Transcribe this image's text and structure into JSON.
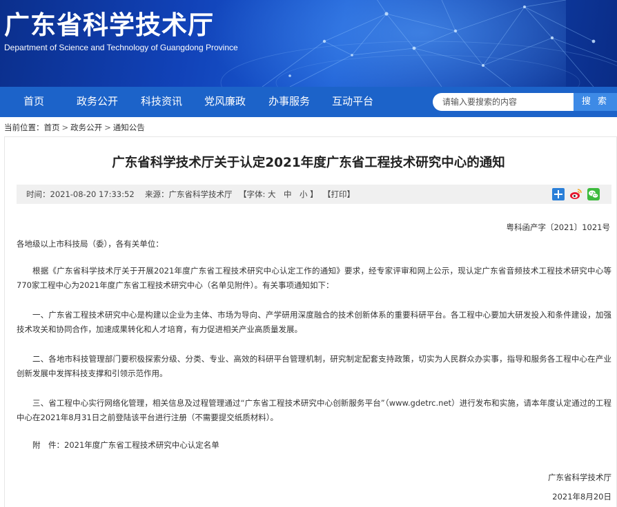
{
  "header": {
    "title": "广东省科学技术厅",
    "subtitle": "Department of Science and Technology of Guangdong Province"
  },
  "nav": {
    "items": [
      "首页",
      "政务公开",
      "科技资讯",
      "党风廉政",
      "办事服务",
      "互动平台"
    ],
    "search_placeholder": "请输入要搜索的内容",
    "search_button": "搜 索"
  },
  "breadcrumb": {
    "label": "当前位置：",
    "items": [
      "首页",
      "政务公开",
      "通知公告"
    ],
    "separator": ">"
  },
  "article": {
    "title": "广东省科学技术厅关于认定2021年度广东省工程技术研究中心的通知",
    "meta": {
      "time": "时间：2021-08-20 17:33:52",
      "source": "来源：广东省科学技术厅",
      "font_size": "【字体: 大　中　小 】",
      "print": "【打印】"
    },
    "share_icons": [
      "share-plus-icon",
      "weibo-icon",
      "wechat-icon"
    ],
    "doc_number": "粤科函产字〔2021〕1021号",
    "salutation": "各地级以上市科技局（委），各有关单位：",
    "paragraphs": [
      "根据《广东省科学技术厅关于开展2021年度广东省工程技术研究中心认定工作的通知》要求，经专家评审和网上公示，现认定广东省音频技术工程技术研究中心等770家工程中心为2021年度广东省工程技术研究中心（名单见附件）。有关事项通知如下：",
      "一、广东省工程技术研究中心是构建以企业为主体、市场为导向、产学研用深度融合的技术创新体系的重要科研平台。各工程中心要加大研发投入和条件建设，加强技术攻关和协同合作，加速成果转化和人才培育，有力促进相关产业高质量发展。",
      "二、各地市科技管理部门要积极探索分级、分类、专业、高效的科研平台管理机制，研究制定配套支持政策，切实为人民群众办实事，指导和服务各工程中心在产业创新发展中发挥科技支撑和引领示范作用。",
      "三、省工程中心实行网络化管理，相关信息及过程管理通过“广东省工程技术研究中心创新服务平台”（www.gdetrc.net）进行发布和实施，请本年度认定通过的工程中心在2021年8月31日之前登陆该平台进行注册（不需要提交纸质材料）。",
      "附　件：2021年度广东省工程技术研究中心认定名单"
    ],
    "signature": "广东省科学技术厅",
    "date": "2021年8月20日"
  },
  "colors": {
    "nav_bg": "#1c63c9",
    "search_button_bg": "#3d8ae6",
    "banner_dark": "#0b2f8c"
  }
}
